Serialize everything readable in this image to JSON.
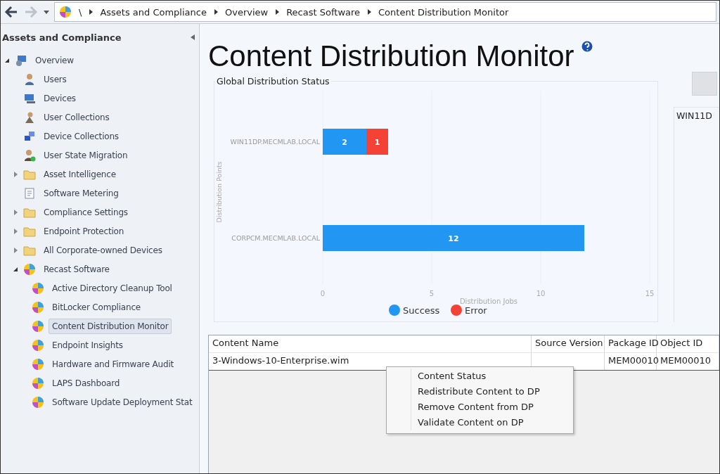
{
  "navigation": {
    "back": {
      "disabled": false
    },
    "forward": {
      "disabled": true
    },
    "breadcrumb": [
      "\\",
      "Assets and Compliance",
      "Overview",
      "Recast Software",
      "Content Distribution Monitor"
    ]
  },
  "sidebar": {
    "title": "Assets and Compliance",
    "items": [
      {
        "label": "Overview",
        "kind": "overview",
        "expanded": true,
        "selected": false,
        "children": [
          {
            "label": "Users",
            "kind": "user",
            "selected": false
          },
          {
            "label": "Devices",
            "kind": "devices",
            "selected": false
          },
          {
            "label": "User Collections",
            "kind": "user-collection",
            "selected": false
          },
          {
            "label": "Device Collections",
            "kind": "device-collection",
            "selected": false
          },
          {
            "label": "User State Migration",
            "kind": "migration",
            "selected": false
          },
          {
            "label": "Asset Intelligence",
            "kind": "folder",
            "expanded": false,
            "selected": false
          },
          {
            "label": "Software Metering",
            "kind": "metering",
            "selected": false
          },
          {
            "label": "Compliance Settings",
            "kind": "folder",
            "expanded": false,
            "selected": false
          },
          {
            "label": "Endpoint Protection",
            "kind": "folder",
            "expanded": false,
            "selected": false
          },
          {
            "label": "All Corporate-owned Devices",
            "kind": "folder",
            "expanded": false,
            "selected": false
          },
          {
            "label": "Recast Software",
            "kind": "recast",
            "expanded": true,
            "selected": false,
            "children": [
              {
                "label": "Active Directory Cleanup Tool",
                "kind": "recast",
                "selected": false
              },
              {
                "label": "BitLocker Compliance",
                "kind": "recast",
                "selected": false
              },
              {
                "label": "Content Distribution Monitor",
                "kind": "recast",
                "selected": true
              },
              {
                "label": "Endpoint Insights",
                "kind": "recast",
                "selected": false
              },
              {
                "label": "Hardware and Firmware Audit",
                "kind": "recast",
                "selected": false
              },
              {
                "label": "LAPS Dashboard",
                "kind": "recast",
                "selected": false
              },
              {
                "label": "Software Update Deployment Stat",
                "kind": "recast",
                "selected": false
              }
            ]
          }
        ]
      }
    ]
  },
  "main": {
    "title": "Content Distribution Monitor",
    "chart_panel": {
      "title": "Global Distribution Status",
      "chart_data": {
        "type": "bar",
        "orientation": "horizontal",
        "stacked": true,
        "xlabel": "Distribution Jobs",
        "ylabel": "Distribution Points",
        "categories": [
          "WIN11DP.MECMLAB.LOCAL",
          "CORPCM.MECMLAB.LOCAL"
        ],
        "series": [
          {
            "name": "Success",
            "color": "#2196f3",
            "values": [
              2,
              12
            ]
          },
          {
            "name": "Error",
            "color": "#f44336",
            "values": [
              1,
              null
            ]
          }
        ],
        "xlim": [
          0,
          15
        ],
        "xticks": [
          0,
          5,
          10,
          15
        ],
        "data_labels": true,
        "legend": true
      }
    },
    "side_panel": {
      "title": "WIN11D"
    },
    "table": {
      "columns": [
        "Content Name",
        "Source Version",
        "Package ID",
        "Object ID"
      ],
      "rows": [
        {
          "selected": false,
          "cells": [
            "3-Windows-10-Enterprise.wim",
            "",
            "MEM00010",
            "MEM00010"
          ]
        }
      ]
    },
    "context_menu": [
      "Content Status",
      "Redistribute Content to DP",
      "Remove Content from DP",
      "Validate Content on DP"
    ]
  }
}
